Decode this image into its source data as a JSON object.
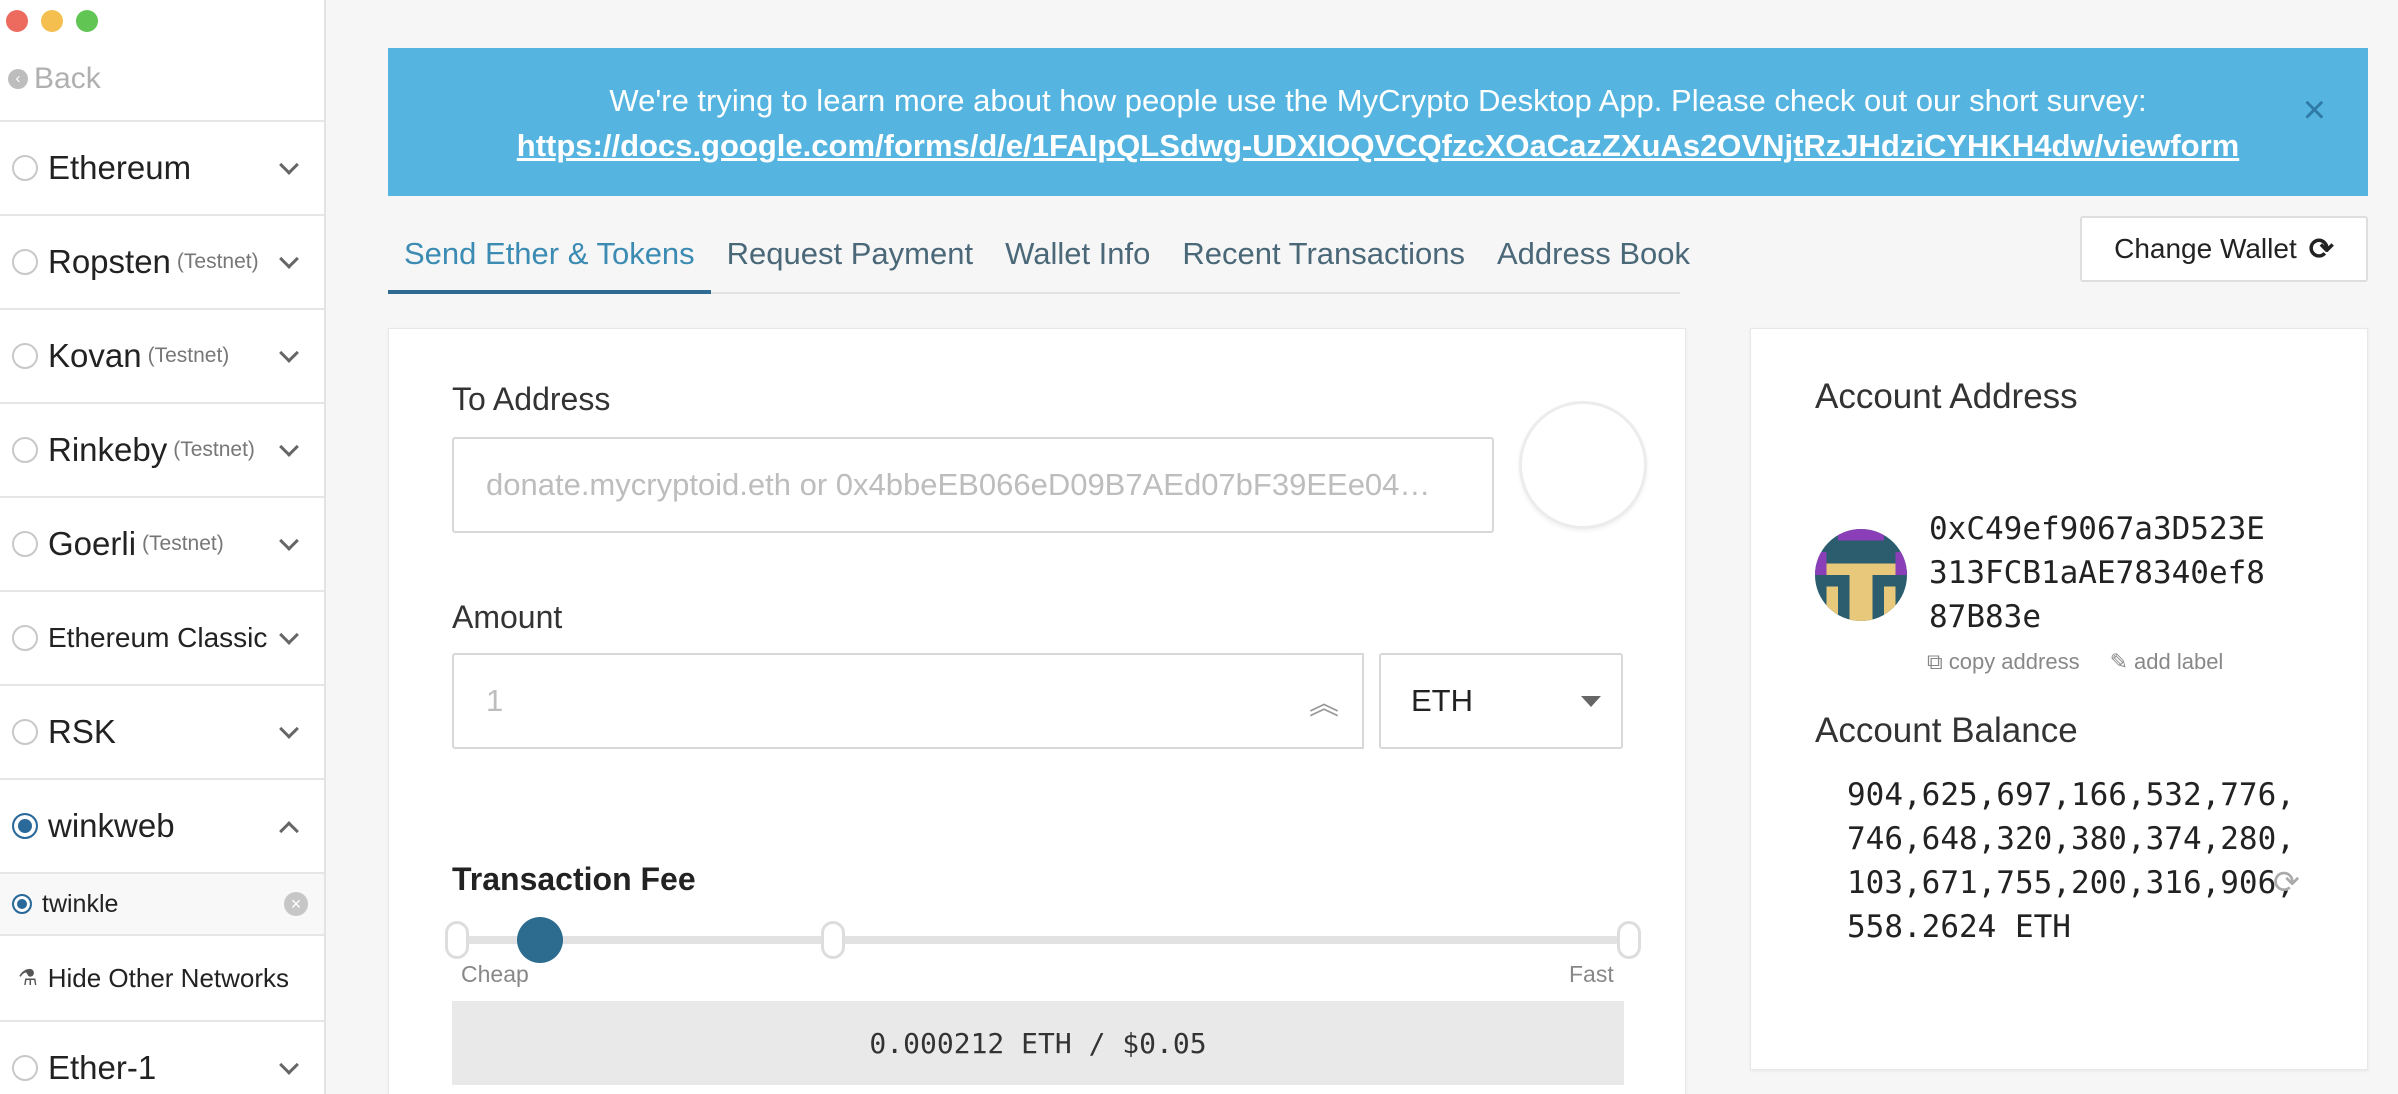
{
  "window": {
    "controls": [
      "close",
      "minimize",
      "maximize"
    ]
  },
  "sidebar": {
    "back_label": "Back",
    "networks": [
      {
        "name": "Ethereum",
        "sub": "",
        "expanded": false,
        "selected": false
      },
      {
        "name": "Ropsten",
        "sub": "(Testnet)",
        "expanded": false,
        "selected": false
      },
      {
        "name": "Kovan",
        "sub": "(Testnet)",
        "expanded": false,
        "selected": false
      },
      {
        "name": "Rinkeby",
        "sub": "(Testnet)",
        "expanded": false,
        "selected": false
      },
      {
        "name": "Goerli",
        "sub": "(Testnet)",
        "expanded": false,
        "selected": false
      },
      {
        "name": "Ethereum Classic",
        "sub": "",
        "expanded": false,
        "selected": false
      },
      {
        "name": "RSK",
        "sub": "",
        "expanded": false,
        "selected": false
      },
      {
        "name": "winkweb",
        "sub": "",
        "expanded": true,
        "selected": true
      }
    ],
    "sub_network": {
      "name": "twinkle",
      "selected": true
    },
    "hide_other_label": "Hide Other Networks",
    "after_networks": [
      {
        "name": "Ether-1",
        "sub": "",
        "expanded": false,
        "selected": false
      }
    ]
  },
  "banner": {
    "text": "We're trying to learn more about how people use the MyCrypto Desktop App. Please check out our short survey:",
    "link": "https://docs.google.com/forms/d/e/1FAIpQLSdwg-UDXIOQVCQfzcXOaCazZXuAs2OVNjtRzJHdziCYHKH4dw/viewform",
    "close_glyph": "×"
  },
  "tabs": [
    "Send Ether & Tokens",
    "Request Payment",
    "Wallet Info",
    "Recent Transactions",
    "Address Book"
  ],
  "active_tab": "Send Ether & Tokens",
  "change_wallet_label": "Change Wallet",
  "send": {
    "to_address_label": "To Address",
    "to_address_placeholder": "donate.mycryptoid.eth or 0x4bbeEB066eD09B7AEd07bF39EEe04…",
    "amount_label": "Amount",
    "amount_placeholder": "1",
    "unit": "ETH",
    "fee_label": "Transaction Fee",
    "fee_min_label": "Cheap",
    "fee_max_label": "Fast",
    "fee_level": 0.07,
    "fee_display": "0.000212 ETH / $0.05"
  },
  "account": {
    "address_title": "Account Address",
    "address": "0xC49ef9067a3D523E313FCB1aAE78340ef887B83e",
    "copy_label": "copy address",
    "add_label": "add label",
    "balance_title": "Account Balance",
    "balance": "904,625,697,166,532,776,746,648,320,380,374,280,103,671,755,200,316,906,558.2624 ETH"
  },
  "colors": {
    "banner_bg": "#55b5e0",
    "accent": "#2d6b8f",
    "tab_active": "#3b8bb3"
  }
}
